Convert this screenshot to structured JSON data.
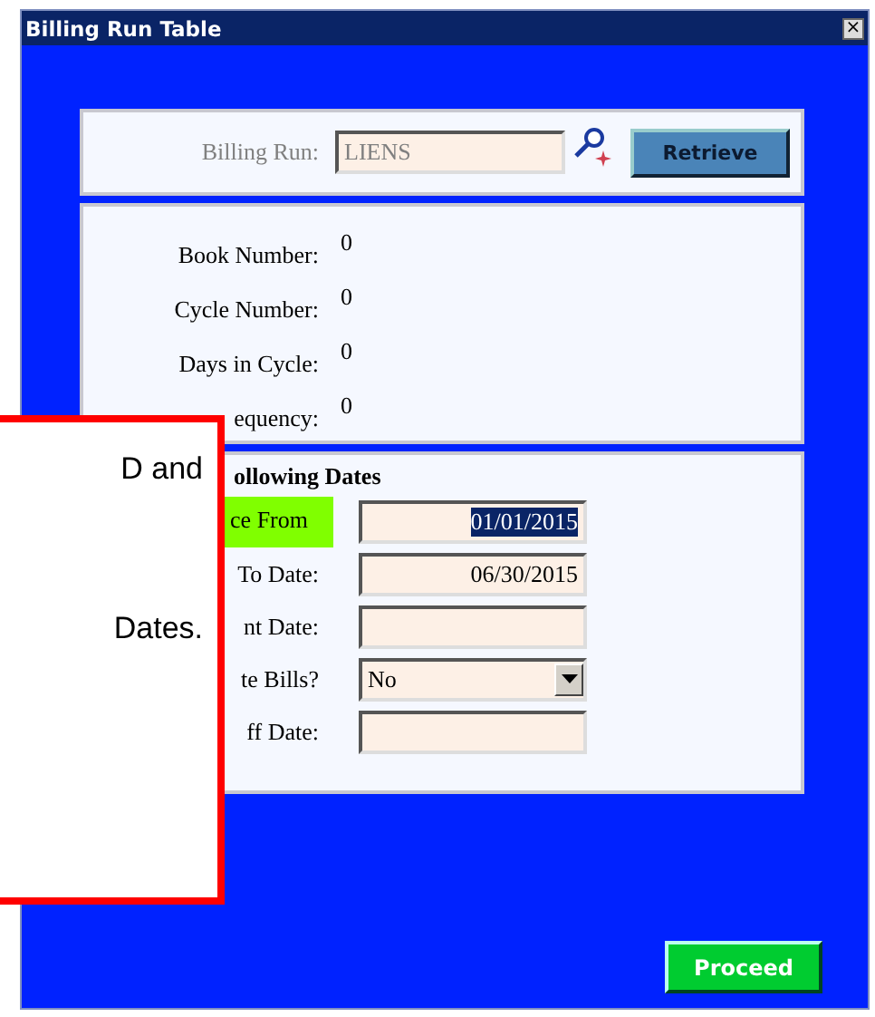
{
  "window": {
    "title": "Billing Run Table",
    "close": "×"
  },
  "billing_run": {
    "label": "Billing Run:",
    "value": "LIENS",
    "disabled": true,
    "button": "Retrieve"
  },
  "info": [
    {
      "label": "Book Number:",
      "value": "0"
    },
    {
      "label": "Cycle Number:",
      "value": "0"
    },
    {
      "label": "Days in Cycle:",
      "value": "0"
    },
    {
      "label": "equency:",
      "value": "0"
    }
  ],
  "dates": {
    "heading": "ollowing Dates",
    "rows": [
      {
        "label": "ce From",
        "kind": "date",
        "value": "01/01/2015",
        "highlighted": true,
        "text_selected": true
      },
      {
        "label": "To Date:",
        "kind": "date",
        "value": "06/30/2015",
        "highlighted": false,
        "text_selected": false
      },
      {
        "label": "nt Date:",
        "kind": "date",
        "highlighted": false
      },
      {
        "label": "te Bills?",
        "kind": "select",
        "value": "No",
        "highlighted": false
      },
      {
        "label": "ff Date:",
        "kind": "date",
        "highlighted": false
      }
    ]
  },
  "proceed": "Proceed",
  "callout": [
    "D and",
    "Dates."
  ]
}
